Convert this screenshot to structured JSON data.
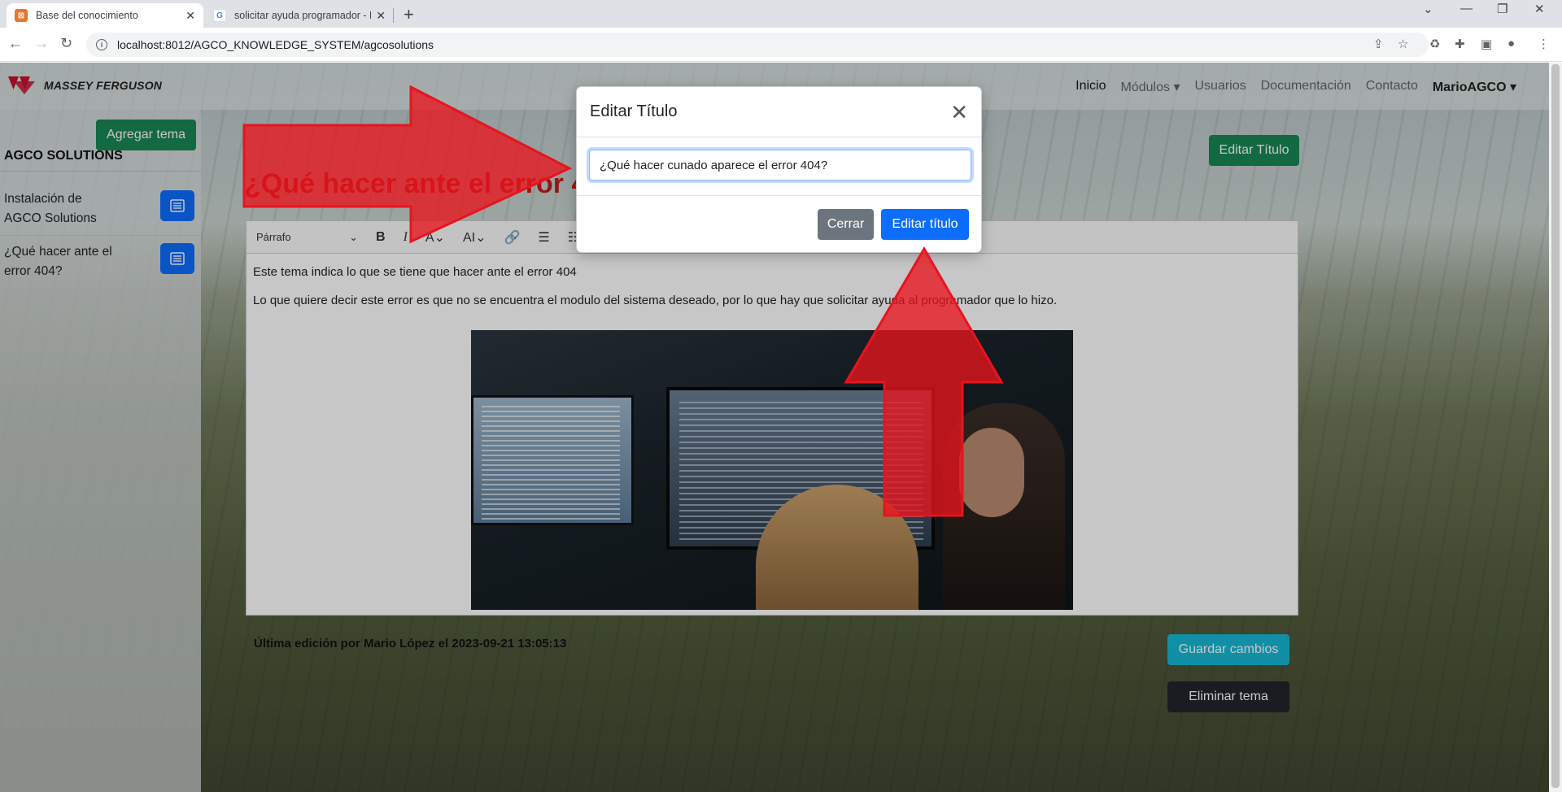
{
  "browser": {
    "tabs": [
      {
        "title": "Base del conocimiento",
        "active": true
      },
      {
        "title": "solicitar ayuda programador - Bú",
        "active": false
      }
    ],
    "new_tab": "+",
    "url": "localhost:8012/AGCO_KNOWLEDGE_SYSTEM/agcosolutions"
  },
  "navbar": {
    "brand": "MASSEY FERGUSON",
    "links": [
      "Inicio",
      "Módulos",
      "Usuarios",
      "Documentación",
      "Contacto"
    ],
    "user": "MarioAGCO"
  },
  "sidebar": {
    "add_button": "Agregar tema",
    "section_title": "AGCO SOLUTIONS",
    "items": [
      {
        "label": "Instalación de AGCO Solutions"
      },
      {
        "label": "¿Qué hacer ante el error 404?"
      }
    ]
  },
  "main": {
    "title": "¿Qué hacer ante el error 4",
    "edit_title_button": "Editar Título",
    "toolbar": {
      "paragraph": "Párrafo"
    },
    "content": [
      "Este tema indica lo que se tiene que hacer ante el error 404",
      "Lo que quiere decir este error es que no se encuentra el modulo del sistema deseado, por lo que hay que solicitar ayuda al programador que lo hizo."
    ],
    "last_edit": "Última edición por Mario López el 2023-09-21 13:05:13",
    "save_button": "Guardar cambios",
    "delete_button": "Eliminar tema"
  },
  "modal": {
    "title": "Editar Título",
    "input_value": "¿Qué hacer cunado aparece el error 404?",
    "close_button": "Cerrar",
    "submit_button": "Editar título"
  },
  "colors": {
    "accent_green": "#198754",
    "accent_blue": "#0d6efd",
    "title_red": "#c71b1b",
    "annotation_red": "#e8141e"
  }
}
